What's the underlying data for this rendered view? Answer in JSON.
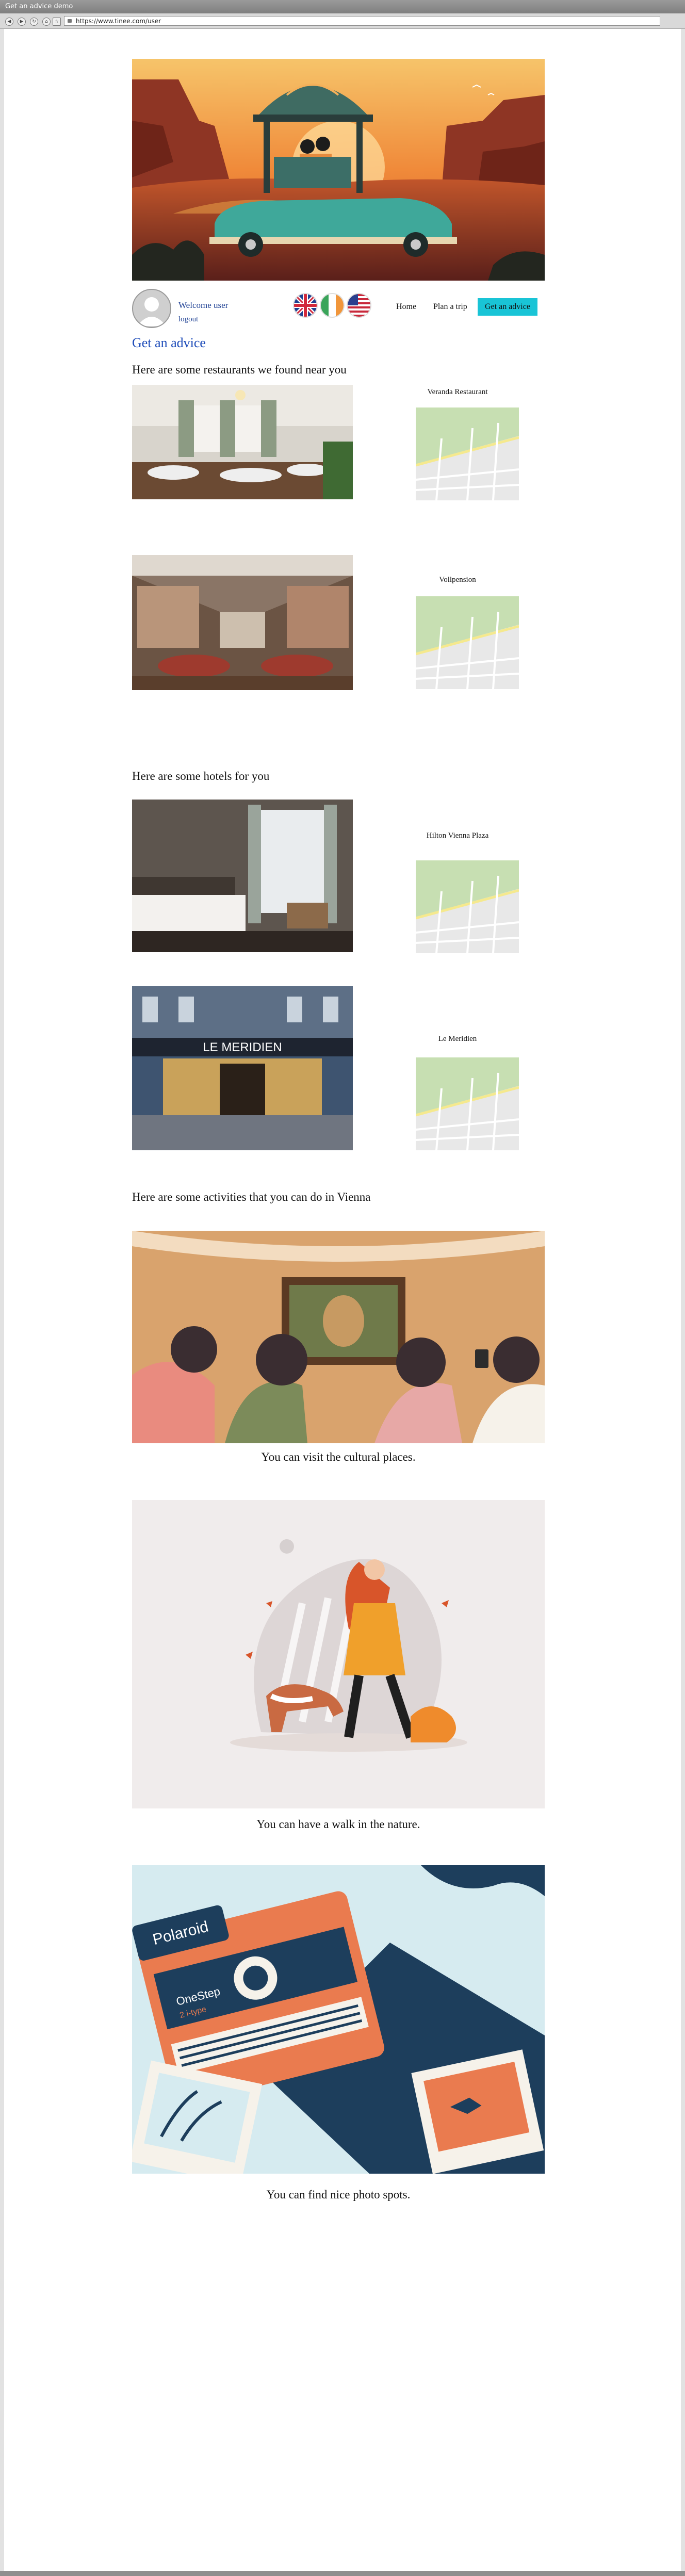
{
  "window": {
    "title": "Get an advice demo"
  },
  "browser": {
    "url": "https://www.tinee.com/user"
  },
  "user": {
    "welcome": "Welcome user",
    "logout": "logout"
  },
  "nav": {
    "home": "Home",
    "plan": "Plan a trip",
    "advice": "Get an advice"
  },
  "page_title": "Get an advice",
  "restaurants": {
    "heading": "Here are some restaurants we found near you",
    "items": [
      {
        "name": "Veranda Restaurant"
      },
      {
        "name": "Vollpension"
      }
    ]
  },
  "hotels": {
    "heading": "Here are some hotels for you",
    "items": [
      {
        "name": "Hilton Vienna Plaza",
        "sign": ""
      },
      {
        "name": "Le Meridien",
        "sign": "LE MERIDIEN"
      }
    ]
  },
  "activities": {
    "heading": "Here are some activities that you can do in Vienna",
    "items": [
      {
        "caption": "You can visit the cultural places."
      },
      {
        "caption": "You can have a walk in the nature."
      },
      {
        "caption": "You can find nice photo spots."
      }
    ]
  },
  "camera_labels": {
    "brand": "Polaroid",
    "model": "OneStep",
    "sub": "2 i-type"
  },
  "colors": {
    "accent": "#19c4d6",
    "link": "#1d3f93",
    "title": "#1a49b8"
  }
}
